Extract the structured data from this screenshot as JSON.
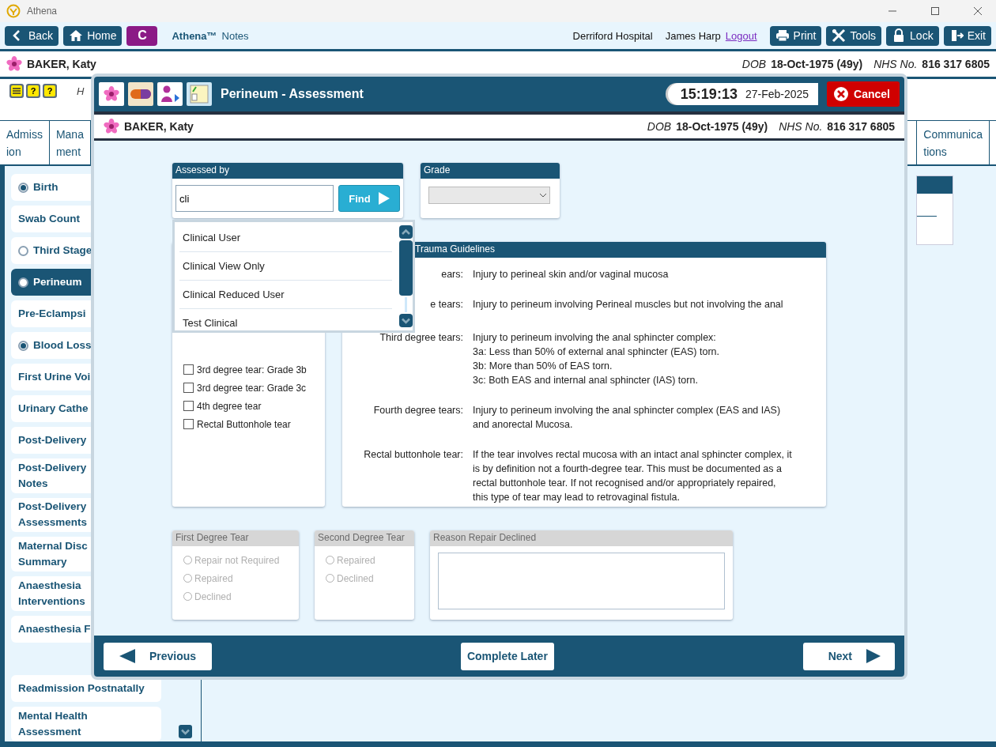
{
  "window": {
    "title": "Athena"
  },
  "toolbar": {
    "left_buttons": [
      {
        "label": "Back"
      },
      {
        "label": "Home"
      }
    ],
    "context_button": "C",
    "brand": "Athena™",
    "app": "Notes",
    "hospital": "Derriford Hospital",
    "user": "James Harp",
    "logout": "Logout",
    "right_buttons": [
      {
        "label": "Print"
      },
      {
        "label": "Tools"
      },
      {
        "label": "Lock"
      },
      {
        "label": "Exit"
      }
    ]
  },
  "patient": {
    "name": "BAKER, Katy",
    "dob_label": "DOB",
    "dob": "18-Oct-1975 (49y)",
    "nhs_label": "NHS No.",
    "nhs": "816 317 6805"
  },
  "alerts": {
    "glyphs": [
      "?",
      "?"
    ],
    "note": "H"
  },
  "tabs": [
    {
      "lines": [
        "Admiss",
        "ion"
      ],
      "selected": false
    },
    {
      "lines": [
        "Mana",
        "ment"
      ],
      "selected": false
    }
  ],
  "right_tabs": [
    {
      "lines": [
        "Communica",
        "tions"
      ],
      "selected": false
    }
  ],
  "sidebar": {
    "items": [
      {
        "label": "Birth",
        "kind": "complete",
        "selected": false
      },
      {
        "label": "Swab Count",
        "kind": "plain",
        "selected": false
      },
      {
        "label": "Third Stage",
        "kind": "incomplete",
        "selected": false
      },
      {
        "label": "Perineum",
        "kind": "incomplete",
        "selected": true
      },
      {
        "label": "Pre-Eclampsi",
        "kind": "plain",
        "selected": false
      },
      {
        "label": "Blood Loss",
        "kind": "complete",
        "selected": false
      },
      {
        "label": "First Urine Voi",
        "kind": "plain",
        "selected": false
      },
      {
        "label": "Urinary Cathe",
        "kind": "plain",
        "selected": false
      },
      {
        "label": "Post-Delivery",
        "kind": "plain",
        "selected": false
      },
      {
        "label": "Post-Delivery\nNotes",
        "kind": "plain",
        "selected": false
      },
      {
        "label": "Post-Delivery\nAssessments",
        "kind": "plain",
        "selected": false
      },
      {
        "label": "Maternal Disc\nSummary",
        "kind": "plain",
        "selected": false
      },
      {
        "label": "Anaesthesia\nInterventions",
        "kind": "plain",
        "selected": false
      },
      {
        "label": "Anaesthesia F",
        "kind": "plain",
        "selected": false
      }
    ],
    "lower_items": [
      {
        "label": "Readmission Postnatally",
        "selected": false
      },
      {
        "label": "Mental Health\nAssessment",
        "selected": false
      }
    ]
  },
  "dialog": {
    "title": "Perineum - Assessment",
    "time": "15:19:13",
    "date": "27-Feb-2025",
    "cancel": "Cancel",
    "patient": {
      "name": "BAKER, Katy",
      "dob_label": "DOB",
      "dob": "18-Oct-1975 (49y)",
      "nhs_label": "NHS No.",
      "nhs": "816 317 6805"
    },
    "assessed_by": {
      "title": "Assessed by",
      "value": "cli",
      "find": "Find"
    },
    "grade": {
      "title": "Grade"
    },
    "suggestions": [
      {
        "label": "Clinical User",
        "selected": false
      },
      {
        "label": "Clinical View Only",
        "selected": false
      },
      {
        "label": "Clinical Reduced User",
        "selected": false
      },
      {
        "label": "Test Clinical",
        "selected": false
      }
    ],
    "tears": [
      {
        "label": "3rd degree tear: Grade 3b",
        "checked": false
      },
      {
        "label": "3rd degree tear: Grade 3c",
        "checked": false
      },
      {
        "label": "4th degree tear",
        "checked": false
      },
      {
        "label": "Rectal Buttonhole tear",
        "checked": false
      }
    ],
    "guidelines": {
      "title": "Trauma Guidelines",
      "rows": [
        {
          "label": "ears:",
          "lines": [
            "Injury to perineal skin and/or vaginal mucosa"
          ]
        },
        {
          "label": "e tears:",
          "lines": [
            "Injury to perineum involving Perineal muscles but not involving the anal"
          ]
        },
        {
          "label": "Third degree tears:",
          "lines": [
            "Injury to perineum involving the anal sphincter complex:",
            "3a: Less than 50%  of external anal sphincter (EAS) torn.",
            "3b: More than 50% of EAS torn.",
            "3c: Both EAS and internal anal sphincter (IAS) torn."
          ]
        },
        {
          "label": "Fourth degree tears:",
          "lines": [
            "Injury to perineum involving the anal sphincter complex (EAS and IAS)",
            "and anorectal Mucosa."
          ]
        },
        {
          "label": "Rectal buttonhole tear:",
          "lines": [
            "If the tear involves rectal mucosa with an intact anal sphincter complex, it",
            "is by definition not a fourth-degree tear.  This must be documented as a",
            "rectal buttonhole tear. If not recognised and/or appropriately repaired,",
            "this type of tear may lead to retrovaginal fistula."
          ]
        }
      ]
    },
    "first_degree": {
      "title": "First Degree Tear",
      "disabled": true,
      "options": [
        {
          "label": "Repair not Required",
          "selected": false
        },
        {
          "label": "Repaired",
          "selected": false
        },
        {
          "label": "Declined",
          "selected": false
        }
      ]
    },
    "second_degree": {
      "title": "Second Degree Tear",
      "disabled": true,
      "options": [
        {
          "label": "Repaired",
          "selected": false
        },
        {
          "label": "Declined",
          "selected": false
        }
      ]
    },
    "reason": {
      "title": "Reason Repair Declined",
      "disabled": true
    },
    "footer": {
      "previous": "Previous",
      "later": "Complete Later",
      "next": "Next"
    }
  }
}
